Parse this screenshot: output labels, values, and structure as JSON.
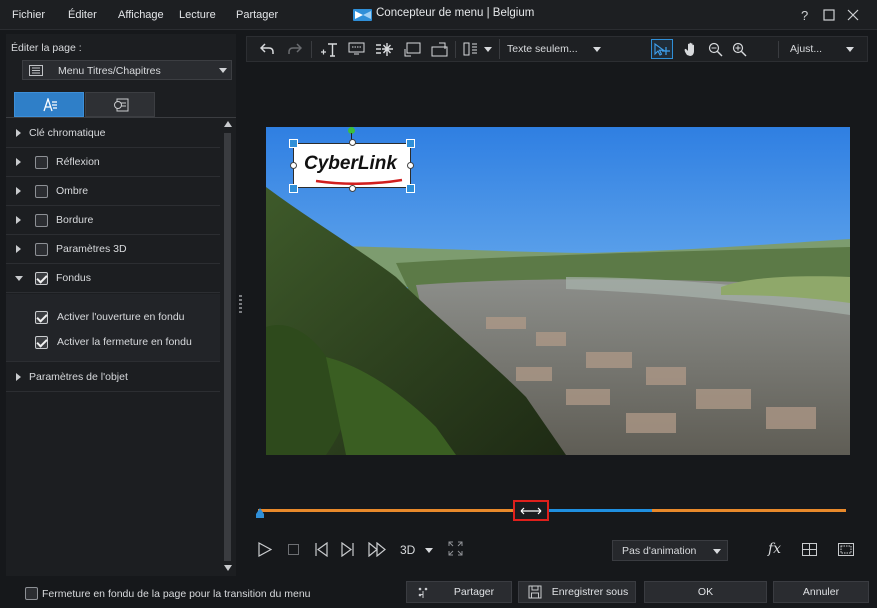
{
  "menu": {
    "file": "Fichier",
    "edit": "Éditer",
    "view": "Affichage",
    "playback": "Lecture",
    "share": "Partager"
  },
  "window": {
    "title": "Concepteur de menu | Belgium",
    "help": "?"
  },
  "page_editor": {
    "label": "Éditer la page :",
    "selected_page": "Menu Titres/Chapitres"
  },
  "properties": [
    {
      "label": "Clé chromatique",
      "expanded": false,
      "has_checkbox": false
    },
    {
      "label": "Réflexion",
      "expanded": false,
      "has_checkbox": true,
      "checked": false
    },
    {
      "label": "Ombre",
      "expanded": false,
      "has_checkbox": true,
      "checked": false
    },
    {
      "label": "Bordure",
      "expanded": false,
      "has_checkbox": true,
      "checked": false
    },
    {
      "label": "Paramètres 3D",
      "expanded": false,
      "has_checkbox": true,
      "checked": false
    },
    {
      "label": "Fondus",
      "expanded": true,
      "has_checkbox": true,
      "checked": true
    }
  ],
  "fade_options": [
    {
      "label": "Activer l'ouverture en fondu",
      "checked": true
    },
    {
      "label": "Activer la fermeture en fondu",
      "checked": true
    }
  ],
  "object_params": {
    "label": "Paramètres de l'objet"
  },
  "toolbar": {
    "text_mode": "Texte seulem...",
    "fit": "Ajust..."
  },
  "preview": {
    "logo_text": "CyberLink"
  },
  "playback": {
    "mode_3d": "3D",
    "animation": "Pas d'animation",
    "fx": "fx"
  },
  "footer": {
    "fade_menu": "Fermeture en fondu de la page pour la transition du menu",
    "fade_menu_checked": false,
    "share": "Partager",
    "save_as": "Enregistrer sous",
    "ok": "OK",
    "cancel": "Annuler"
  },
  "colors": {
    "accent": "#2f8fd8",
    "timeline_orange": "#e8892b",
    "timeline_blue": "#1f8fe0",
    "marker": "#e0201c",
    "handle_green": "#3cbf3c"
  }
}
